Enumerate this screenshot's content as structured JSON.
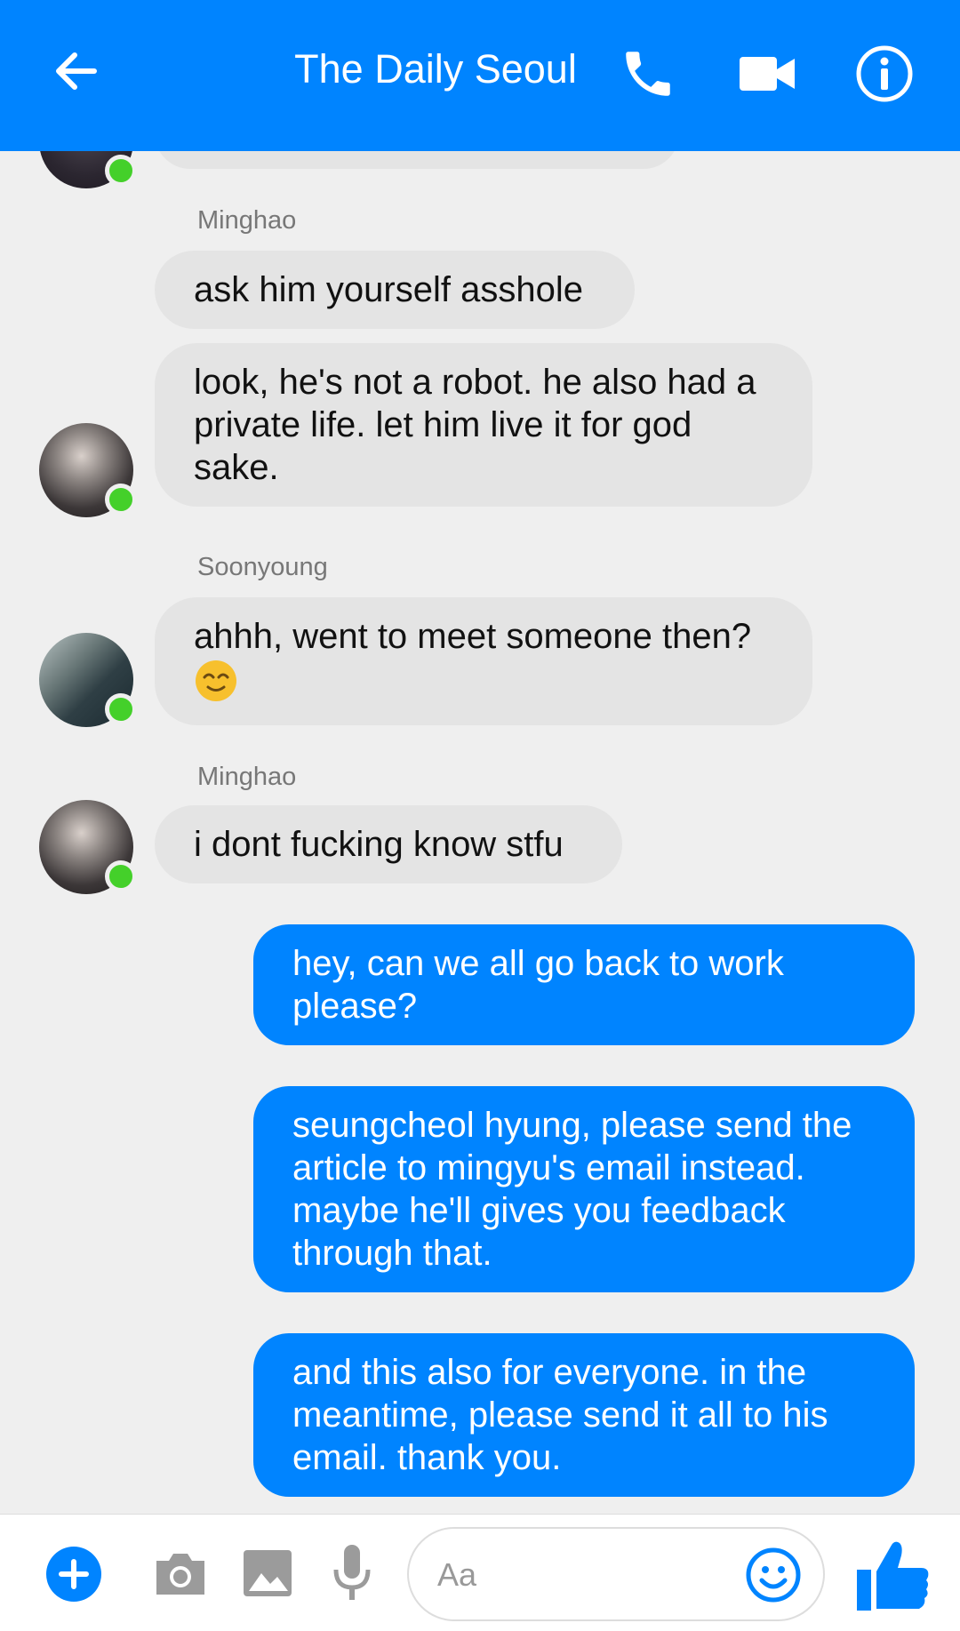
{
  "header": {
    "title": "The Daily Seoul",
    "back_icon": "arrow-left-icon",
    "call_icon": "phone-icon",
    "video_icon": "video-camera-icon",
    "info_icon": "info-icon"
  },
  "messages": [
    {
      "sender": "Minghao"
    },
    {
      "text": "ask him yourself asshole"
    },
    {
      "text": "look, he's not a robot. he also had a private life. let him live it for god sake."
    },
    {
      "sender": "Soonyoung"
    },
    {
      "text": "ahhh, went to meet someone then?"
    },
    {
      "sender": "Minghao"
    },
    {
      "text": "i dont fucking know stfu"
    },
    {
      "text": "hey, can we all go back to work please?"
    },
    {
      "text": "seungcheol hyung, please send the article to mingyu's email instead. maybe he'll gives you feedback through that."
    },
    {
      "text": "and this also for everyone. in the meantime, please send it all to his email. thank you."
    }
  ],
  "composer": {
    "placeholder": "Aa"
  },
  "colors": {
    "accent": "#0084ff",
    "incoming_bubble": "#e4e4e4",
    "online": "#44d02a",
    "background": "#efefef"
  }
}
